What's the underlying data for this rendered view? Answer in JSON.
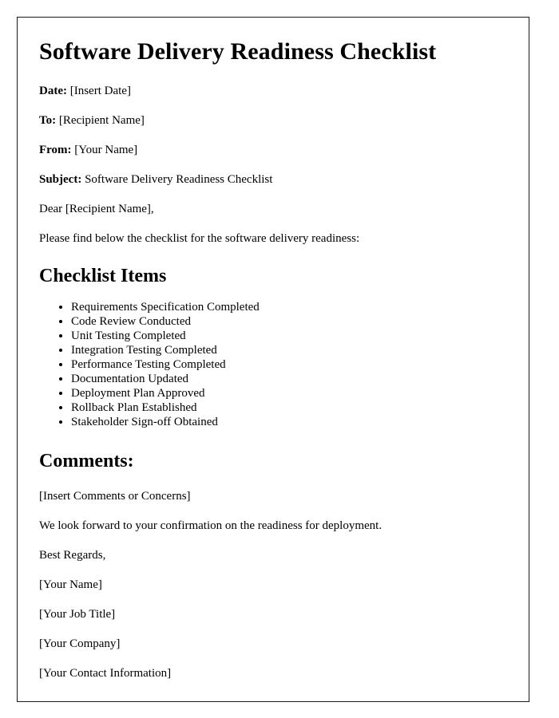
{
  "document": {
    "title": "Software Delivery Readiness Checklist",
    "fields": [
      {
        "label": "Date:",
        "value": "[Insert Date]"
      },
      {
        "label": "To:",
        "value": "[Recipient Name]"
      },
      {
        "label": "From:",
        "value": "[Your Name]"
      },
      {
        "label": "Subject:",
        "value": "Software Delivery Readiness Checklist"
      }
    ],
    "salutation": "Dear [Recipient Name],",
    "intro": "Please find below the checklist for the software delivery readiness:",
    "checklist_heading": "Checklist Items",
    "checklist_items": [
      "Requirements Specification Completed",
      "Code Review Conducted",
      "Unit Testing Completed",
      "Integration Testing Completed",
      "Performance Testing Completed",
      "Documentation Updated",
      "Deployment Plan Approved",
      "Rollback Plan Established",
      "Stakeholder Sign-off Obtained"
    ],
    "comments_heading": "Comments:",
    "comments_placeholder": "[Insert Comments or Concerns]",
    "closing_statement": "We look forward to your confirmation on the readiness for deployment.",
    "sign_off": "Best Regards,",
    "signature": [
      "[Your Name]",
      "[Your Job Title]",
      "[Your Company]",
      "[Your Contact Information]"
    ]
  }
}
